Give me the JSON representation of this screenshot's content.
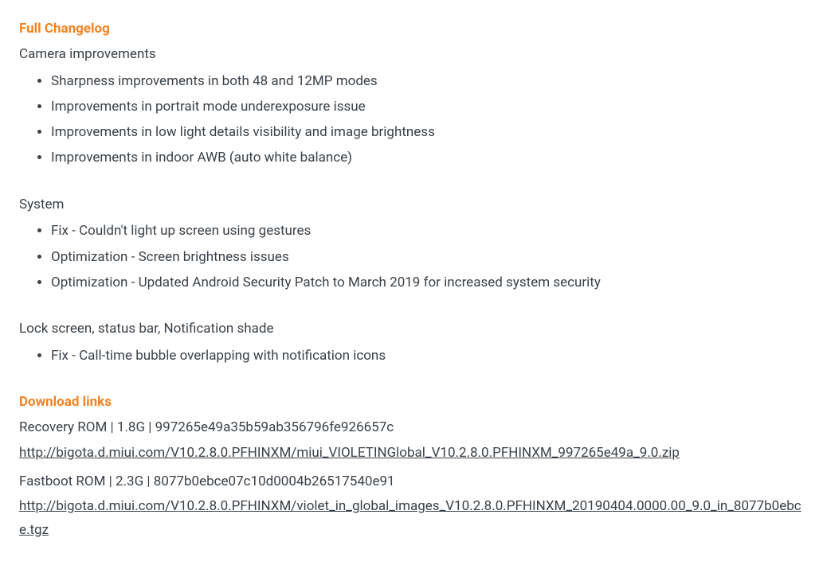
{
  "changelog": {
    "heading": "Full Changelog",
    "sections": [
      {
        "title": "Camera improvements",
        "items": [
          "Sharpness improvements in both 48 and 12MP modes",
          "Improvements in portrait mode underexposure issue",
          "Improvements in low light details visibility and image brightness",
          "Improvements in indoor AWB (auto white balance)"
        ]
      },
      {
        "title": "System",
        "items": [
          "Fix - Couldn't light up screen using gestures",
          "Optimization - Screen brightness issues",
          "Optimization - Updated Android Security Patch to March 2019 for increased system security"
        ]
      },
      {
        "title": "Lock screen, status bar, Notification shade",
        "items": [
          "Fix - Call-time bubble overlapping with notification icons"
        ]
      }
    ]
  },
  "downloads": {
    "heading": "Download links",
    "roms": [
      {
        "line": "Recovery ROM | 1.8G | 997265e49a35b59ab356796fe926657c",
        "url": "http://bigota.d.miui.com/V10.2.8.0.PFHINXM/miui_VIOLETINGlobal_V10.2.8.0.PFHINXM_997265e49a_9.0.zip"
      },
      {
        "line": "Fastboot ROM | 2.3G | 8077b0ebce07c10d0004b26517540e91",
        "url": "http://bigota.d.miui.com/V10.2.8.0.PFHINXM/violet_in_global_images_V10.2.8.0.PFHINXM_20190404.0000.00_9.0_in_8077b0ebce.tgz"
      }
    ]
  }
}
